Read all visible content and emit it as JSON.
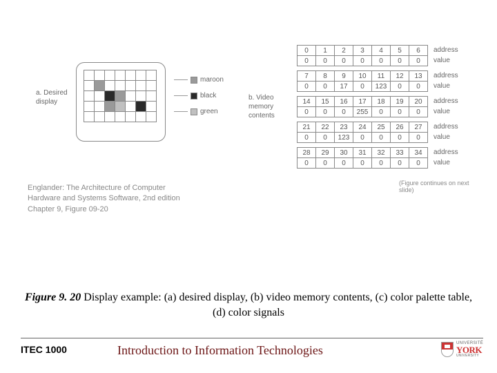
{
  "panel_a": {
    "label": "a. Desired display",
    "legend": [
      {
        "name": "maroon"
      },
      {
        "name": "black"
      },
      {
        "name": "green"
      }
    ],
    "grid_colors": [
      [
        "",
        "",
        "",
        "",
        "",
        "",
        ""
      ],
      [
        "",
        "maroon",
        "",
        "",
        "",
        "",
        ""
      ],
      [
        "",
        "",
        "black",
        "maroon",
        "",
        "",
        ""
      ],
      [
        "",
        "",
        "maroon",
        "green",
        "",
        "black",
        ""
      ],
      [
        "",
        "",
        "",
        "",
        "",
        "",
        ""
      ]
    ]
  },
  "panel_b": {
    "label": "b. Video memory contents",
    "side_labels": {
      "addr": "address",
      "val": "value"
    },
    "rows": [
      {
        "addr": [
          0,
          1,
          2,
          3,
          4,
          5,
          6
        ],
        "val": [
          0,
          0,
          0,
          0,
          0,
          0,
          0
        ]
      },
      {
        "addr": [
          7,
          8,
          9,
          10,
          11,
          12,
          13
        ],
        "val": [
          0,
          0,
          17,
          0,
          123,
          0,
          0
        ]
      },
      {
        "addr": [
          14,
          15,
          16,
          17,
          18,
          19,
          20
        ],
        "val": [
          0,
          0,
          0,
          255,
          0,
          0,
          0
        ]
      },
      {
        "addr": [
          21,
          22,
          23,
          24,
          25,
          26,
          27
        ],
        "val": [
          0,
          0,
          123,
          0,
          0,
          0,
          0
        ]
      },
      {
        "addr": [
          28,
          29,
          30,
          31,
          32,
          33,
          34
        ],
        "val": [
          0,
          0,
          0,
          0,
          0,
          0,
          0
        ]
      }
    ],
    "continues": "(Figure continues on next slide)"
  },
  "citation": {
    "line1": "Englander: The Architecture of Computer",
    "line2": "Hardware and Systems Software, 2nd edition",
    "line3": "Chapter 9, Figure 09-20"
  },
  "caption": {
    "fignum": "Figure 9. 20",
    "text": " Display example: (a) desired display, (b) video memory contents, (c) color palette table, (d) color signals"
  },
  "footer": {
    "course_code": "ITEC 1000",
    "course_title": "Introduction to Information Technologies",
    "logo": {
      "uni": "UNIVERSITÉ",
      "york": "YORK",
      "sub": "UNIVERSITY"
    }
  }
}
